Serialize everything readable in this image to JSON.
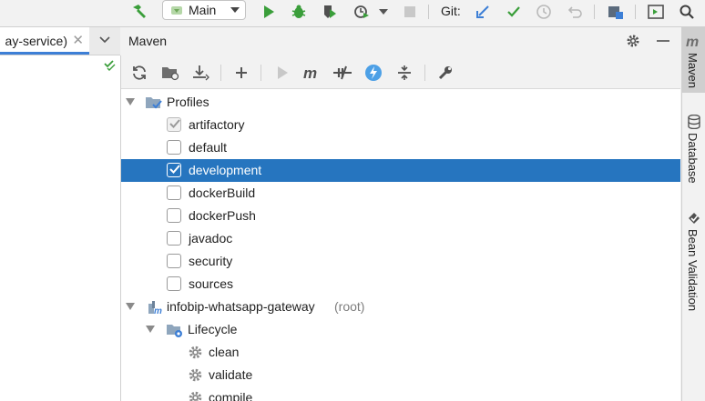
{
  "toolbar": {
    "run_config": "Main",
    "git_label": "Git:"
  },
  "editor": {
    "tab_label": "ay-service)",
    "close_glyph": "✕"
  },
  "maven": {
    "title": "Maven",
    "tree": {
      "profiles_label": "Profiles",
      "profiles": [
        {
          "label": "artifactory",
          "checked": true
        },
        {
          "label": "default",
          "checked": false
        },
        {
          "label": "development",
          "checked": true
        },
        {
          "label": "dockerBuild",
          "checked": false
        },
        {
          "label": "dockerPush",
          "checked": false
        },
        {
          "label": "javadoc",
          "checked": false
        },
        {
          "label": "security",
          "checked": false
        },
        {
          "label": "sources",
          "checked": false
        }
      ],
      "project": {
        "name": "infobip-whatsapp-gateway",
        "suffix": "(root)"
      },
      "lifecycle_label": "Lifecycle",
      "lifecycle": [
        "clean",
        "validate",
        "compile"
      ]
    }
  },
  "right_stripe": {
    "tabs": [
      "Maven",
      "Database",
      "Bean Validation"
    ]
  },
  "colors": {
    "selection": "#2675bf",
    "run_green": "#3a9e3a",
    "git_blue": "#3d7fd6"
  }
}
